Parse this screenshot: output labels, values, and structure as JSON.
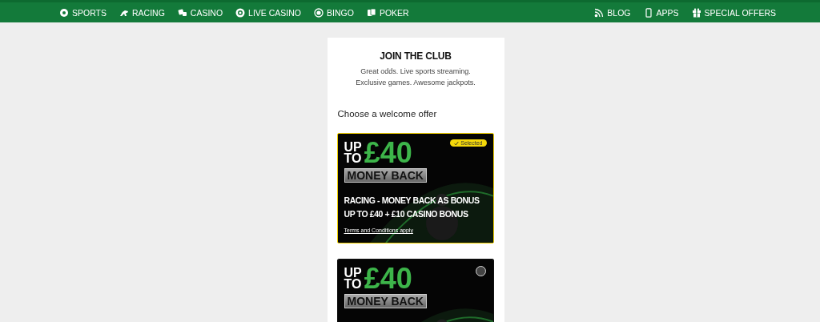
{
  "nav": {
    "left": [
      {
        "label": "SPORTS"
      },
      {
        "label": "RACING"
      },
      {
        "label": "CASINO"
      },
      {
        "label": "LIVE CASINO"
      },
      {
        "label": "BINGO"
      },
      {
        "label": "POKER"
      }
    ],
    "right": [
      {
        "label": "BLOG"
      },
      {
        "label": "APPS"
      },
      {
        "label": "SPECIAL OFFERS"
      }
    ]
  },
  "join": {
    "title": "JOIN THE CLUB",
    "lines": [
      "Great odds. Live sports streaming.",
      "Exclusive games. Awesome jackpots."
    ]
  },
  "offers_heading": "Choose a welcome offer",
  "offers": [
    {
      "selected": true,
      "selected_label": "Selected",
      "up": "UP",
      "to": "TO",
      "amount": "£40",
      "tag": "MONEY BACK",
      "headline": [
        "RACING - MONEY BACK AS BONUS",
        "UP TO £40 + £10 CASINO BONUS"
      ],
      "terms": "Terms and Conditions apply"
    },
    {
      "selected": false,
      "up": "UP",
      "to": "TO",
      "amount": "£40",
      "tag": "MONEY BACK"
    }
  ]
}
